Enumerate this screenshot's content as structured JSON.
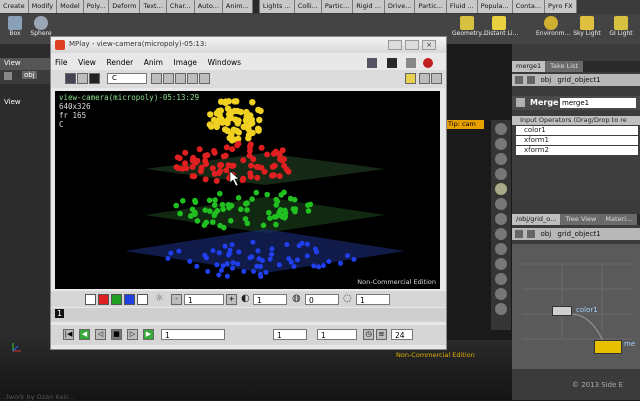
{
  "shelf": {
    "tabs": [
      "Create",
      "Modify",
      "Model",
      "Poly...",
      "Deform",
      "Text...",
      "Char...",
      "Auto...",
      "Anim...",
      "Lights ...",
      "Colli...",
      "Partic...",
      "Rigid ...",
      "Drive...",
      "Partic...",
      "Fluid ...",
      "Popula...",
      "Conta...",
      "Pyro FX"
    ],
    "tools": [
      "Box",
      "Sphere",
      "Geometry...",
      "Distant Li...",
      "Environm...",
      "Sky Light",
      "GI Light"
    ]
  },
  "left": {
    "view_tab": "View",
    "path": "obj",
    "view_label": "View"
  },
  "mplay": {
    "title": "MPlay - view-camera(micropoly)-05:13:",
    "menu": [
      "File",
      "View",
      "Render",
      "Anim",
      "Image",
      "Windows"
    ],
    "channel": "C",
    "overlay": {
      "camera": "view-camera(micropoly)-05:13:29",
      "res": "640x326",
      "frame": "fr 165",
      "channel": "C"
    },
    "non_commercial": "Non-Commercial Edition",
    "frame_marker": "1",
    "controls": {
      "gamma": "1",
      "exposure": "1",
      "black": "0",
      "white": "1",
      "start": "1",
      "cur": "1",
      "end": "1",
      "fps": "24",
      "frame_field": "1"
    },
    "swatch_colors": [
      "#e02020",
      "#20a020",
      "#2040e0"
    ]
  },
  "merge": {
    "tab": "merge1",
    "take_tab": "Take List",
    "path_root": "obj",
    "path_node": "grid_object1",
    "node_type": "Merge",
    "node_name": "merge1",
    "section": "Input Operators (Drag/Drop to re",
    "inputs": [
      "color1",
      "xform1",
      "xform2"
    ]
  },
  "network": {
    "tabs": [
      "/obj/grid_o...",
      "Tree View",
      "Materi..."
    ],
    "path_root": "obj",
    "path_node": "grid_object1",
    "node": "color1",
    "node2": "me"
  },
  "scene_hint": "Tip: cam",
  "nce_bottom": "Non-Commercial Edition",
  "copyright": "© 2013 Side E",
  "watermark": "...twork by Ozan Kaic..."
}
